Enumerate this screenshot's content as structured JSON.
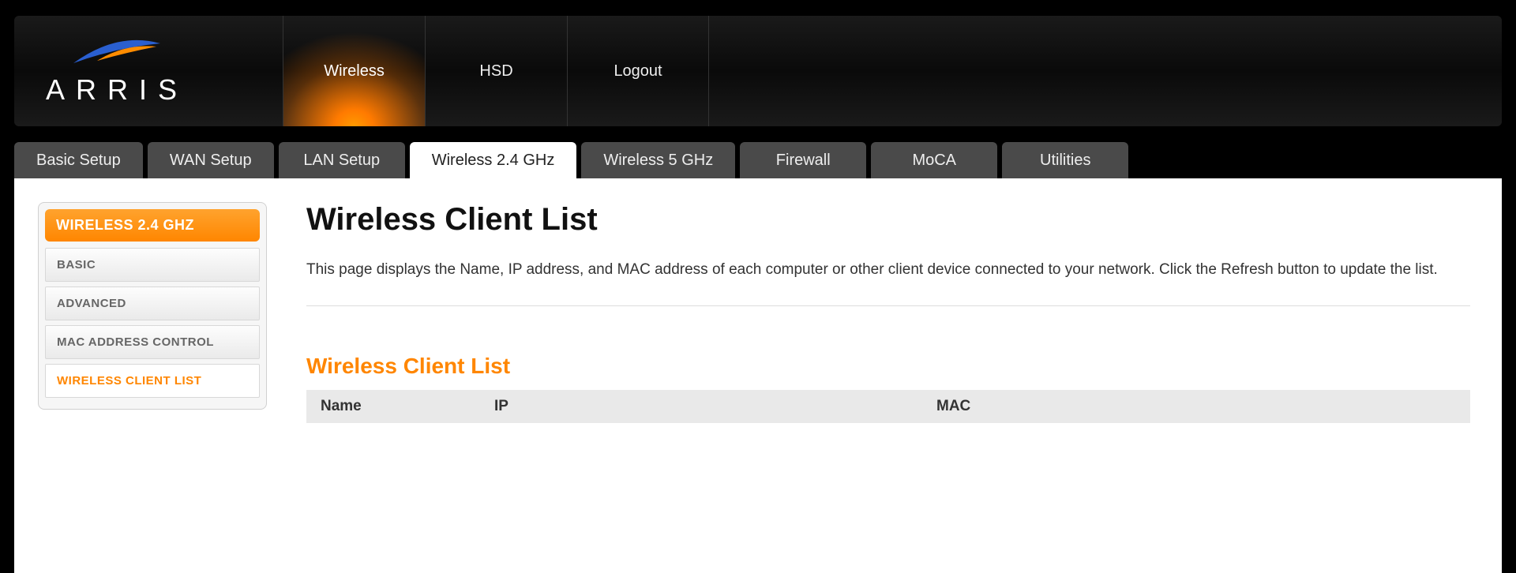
{
  "brand": {
    "name": "ARRIS"
  },
  "topnav": [
    {
      "label": "Wireless",
      "active": true
    },
    {
      "label": "HSD",
      "active": false
    },
    {
      "label": "Logout",
      "active": false
    }
  ],
  "subtabs": [
    {
      "label": "Basic Setup",
      "active": false
    },
    {
      "label": "WAN Setup",
      "active": false
    },
    {
      "label": "LAN Setup",
      "active": false
    },
    {
      "label": "Wireless 2.4 GHz",
      "active": true
    },
    {
      "label": "Wireless 5 GHz",
      "active": false
    },
    {
      "label": "Firewall",
      "active": false
    },
    {
      "label": "MoCA",
      "active": false
    },
    {
      "label": "Utilities",
      "active": false
    }
  ],
  "sidebar": {
    "header": "WIRELESS 2.4 GHZ",
    "items": [
      {
        "label": "BASIC",
        "active": false
      },
      {
        "label": "ADVANCED",
        "active": false
      },
      {
        "label": "MAC ADDRESS CONTROL",
        "active": false
      },
      {
        "label": "WIRELESS CLIENT LIST",
        "active": true
      }
    ]
  },
  "page": {
    "title": "Wireless Client List",
    "description": "This page displays the Name, IP address, and MAC address of each computer or other client device connected to your network. Click the Refresh button to update the list.",
    "section_title": "Wireless Client List",
    "columns": {
      "name": "Name",
      "ip": "IP",
      "mac": "MAC"
    }
  }
}
